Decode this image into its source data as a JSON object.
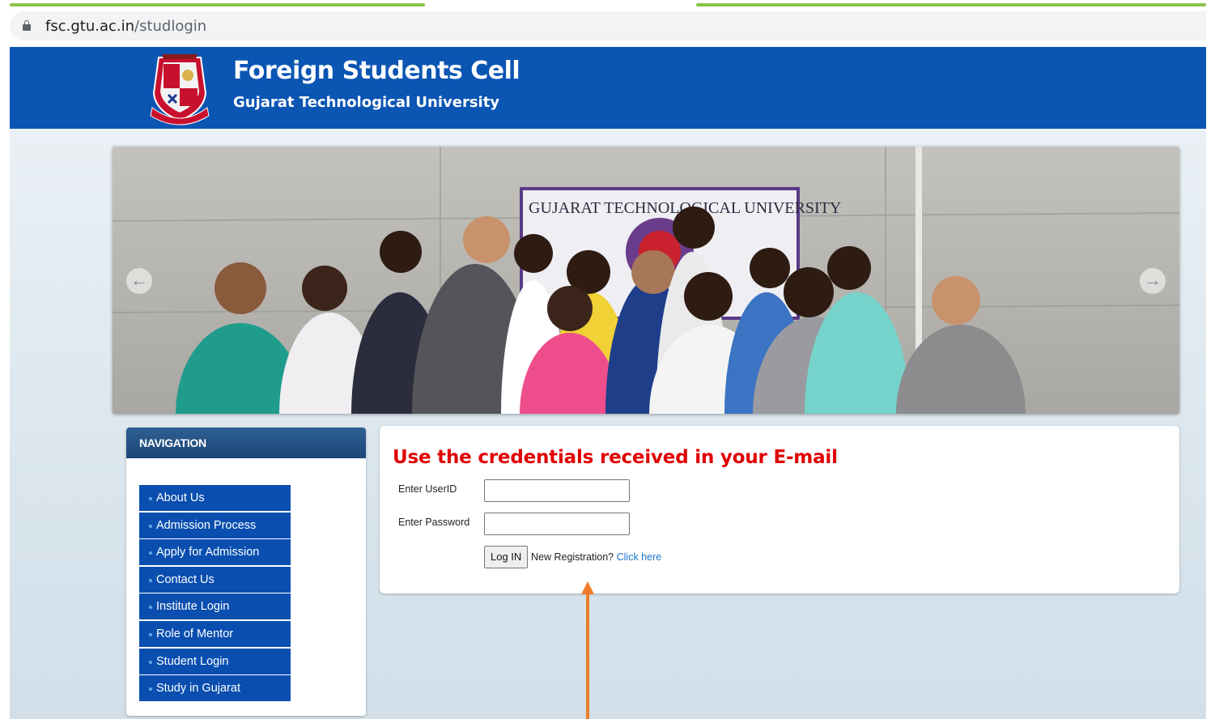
{
  "browser": {
    "url_domain": "fsc.gtu.ac.in",
    "url_path": "/studlogin"
  },
  "header": {
    "title": "Foreign Students Cell",
    "subtitle": "Gujarat Technological University"
  },
  "slider": {
    "banner_text": "GUJARAT TECHNOLOGICAL UNIVERSITY",
    "prev_icon": "arrow-left-icon",
    "next_icon": "arrow-right-icon"
  },
  "navigation": {
    "title": "NAVIGATION",
    "items": [
      {
        "label": "About Us"
      },
      {
        "label": "Admission Process"
      },
      {
        "label": "Apply for Admission"
      },
      {
        "label": "Contact Us"
      },
      {
        "label": "Institute Login"
      },
      {
        "label": "Role of Mentor"
      },
      {
        "label": "Student Login"
      },
      {
        "label": "Study in Gujarat"
      }
    ]
  },
  "login": {
    "heading": "Use the credentials received in your E-mail",
    "userid_label": "Enter UserID",
    "userid_value": "",
    "password_label": "Enter Password",
    "password_value": "",
    "button_label": "Log IN",
    "new_registration_text": "New Registration?",
    "click_here_link": "Click here"
  },
  "colors": {
    "header_blue": "#0b55b3",
    "nav_item_blue": "#0a4fb0",
    "heading_red": "#e00000",
    "link_blue": "#1a73c8",
    "annotation_orange": "#f07c2a"
  }
}
